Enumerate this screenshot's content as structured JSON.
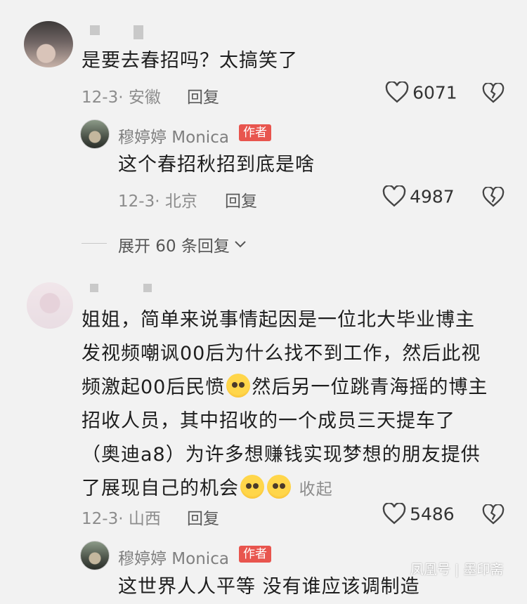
{
  "comments": [
    {
      "text": "是要去春招吗？太搞笑了",
      "meta": "12-3· 安徽",
      "reply_label": "回复",
      "likes": "6071"
    },
    {
      "author": "穆婷婷 Monica",
      "badge": "作者",
      "text": "这个春招秋招到底是啥",
      "meta": "12-3· 北京",
      "reply_label": "回复",
      "likes": "4987"
    },
    {
      "expand_label": "展开 60 条回复"
    },
    {
      "lines": [
        "姐姐，简单来说事情起因是一位北大毕业博主",
        "发视频嘲讽00后为什么找不到工作，然后此视",
        "频激起00后民愤",
        "然后另一位跳青海摇的博主",
        "招收人员，其中招收的一个成员三天提车了",
        "（奥迪a8）为许多想赚钱实现梦想的朋友提供",
        "了展现自己的机会"
      ],
      "collapse_label": "收起",
      "meta": "12-3· 山西",
      "reply_label": "回复",
      "likes": "5486"
    },
    {
      "author": "穆婷婷 Monica",
      "badge": "作者",
      "text_partial": "这世界人人平等 没有谁应该调制造"
    }
  ],
  "watermark": "凤凰号 | 墨印斋",
  "icons": {
    "like": "heart-outline-icon",
    "dislike": "broken-heart-icon",
    "expand": "chevron-down-icon",
    "emoji_laugh": "laugh-cry-emoji",
    "emoji_plead": "pleading-emoji"
  }
}
